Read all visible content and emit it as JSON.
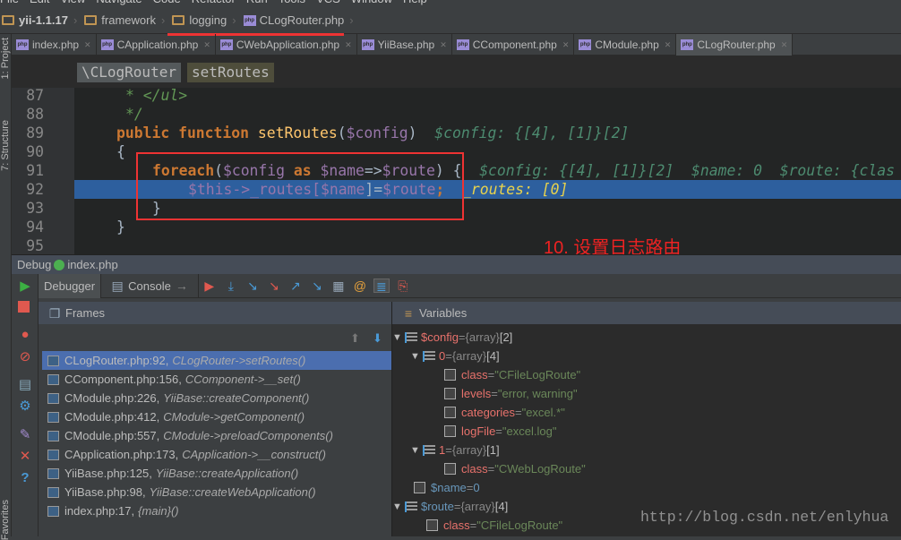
{
  "menu": [
    "File",
    "Edit",
    "View",
    "Navigate",
    "Code",
    "Refactor",
    "Run",
    "Tools",
    "VCS",
    "Window",
    "Help"
  ],
  "breadcrumb": [
    "yii-1.1.17",
    "framework",
    "logging",
    "CLogRouter.php"
  ],
  "side_labels": {
    "project": "1: Project",
    "structure": "7: Structure",
    "favorites": "Favorites"
  },
  "tabs": [
    "index.php",
    "CApplication.php",
    "CWebApplication.php",
    "YiiBase.php",
    "CComponent.php",
    "CModule.php",
    "CLogRouter.php"
  ],
  "active_tab": "CLogRouter.php",
  "editor_nav": {
    "class": "\\CLogRouter",
    "method": "setRoutes"
  },
  "code": {
    "lines": [
      "87",
      "88",
      "89",
      "90",
      "91",
      "92",
      "93",
      "94",
      "95"
    ],
    "l87": "* </ul>",
    "l88": "*/",
    "l89_kw": "public function ",
    "l89_fn": "setRoutes",
    "l89_p1": "(",
    "l89_v": "$config",
    "l89_p2": ")",
    "l89_dbg": "$config: {[4], [1]}[2]",
    "l90": "{",
    "l91_kw": "foreach",
    "l91_p1": "(",
    "l91_v1": "$config",
    "l91_as": " as ",
    "l91_v2": "$name",
    "l91_arrow": "=>",
    "l91_v3": "$route",
    "l91_p2": ") {",
    "l91_dbg": "$config: {[4], [1]}[2]  $name: 0  $route: {clas",
    "l92_a": "$this->_routes[",
    "l92_b": "$name",
    "l92_c": "]=",
    "l92_d": "$route",
    "l92_e": ";",
    "l92_dbg1": "_routes: ",
    "l92_dbg2": "[0]",
    "l93": "}",
    "l94": "}"
  },
  "annotation": "10. 设置日志路由",
  "debug": {
    "title": "Debug",
    "config": "index.php",
    "tab_debugger": "Debugger",
    "tab_console": "Console"
  },
  "frames": {
    "title": "Frames",
    "items": [
      {
        "loc": "CLogRouter.php:92,",
        "fn": "CLogRouter->setRoutes()"
      },
      {
        "loc": "CComponent.php:156,",
        "fn": "CComponent->__set()"
      },
      {
        "loc": "CModule.php:226,",
        "fn": "YiiBase::createComponent()"
      },
      {
        "loc": "CModule.php:412,",
        "fn": "CModule->getComponent()"
      },
      {
        "loc": "CModule.php:557,",
        "fn": "CModule->preloadComponents()"
      },
      {
        "loc": "CApplication.php:173,",
        "fn": "CApplication->__construct()"
      },
      {
        "loc": "YiiBase.php:125,",
        "fn": "YiiBase::createApplication()"
      },
      {
        "loc": "YiiBase.php:98,",
        "fn": "YiiBase::createWebApplication()"
      },
      {
        "loc": "index.php:17,",
        "fn": "{main}()"
      }
    ]
  },
  "variables": {
    "title": "Variables",
    "items": [
      {
        "name": "$config",
        "type": "{array}",
        "val": "[2]",
        "kind": "array",
        "indent": 0,
        "tri": true,
        "blue": false
      },
      {
        "name": "0",
        "type": "{array}",
        "val": "[4]",
        "kind": "array",
        "indent": 1,
        "tri": true,
        "blue": false
      },
      {
        "name": "class",
        "type": "",
        "val": "\"CFileLogRoute\"",
        "kind": "prim",
        "indent": 2,
        "tri": false,
        "blue": false
      },
      {
        "name": "levels",
        "type": "",
        "val": "\"error, warning\"",
        "kind": "prim",
        "indent": 2,
        "tri": false,
        "blue": false
      },
      {
        "name": "categories",
        "type": "",
        "val": "\"excel.*\"",
        "kind": "prim",
        "indent": 2,
        "tri": false,
        "blue": false
      },
      {
        "name": "logFile",
        "type": "",
        "val": "\"excel.log\"",
        "kind": "prim",
        "indent": 2,
        "tri": false,
        "blue": false
      },
      {
        "name": "1",
        "type": "{array}",
        "val": "[1]",
        "kind": "array",
        "indent": 1,
        "tri": true,
        "blue": false
      },
      {
        "name": "class",
        "type": "",
        "val": "\"CWebLogRoute\"",
        "kind": "prim",
        "indent": 2,
        "tri": false,
        "blue": false
      },
      {
        "name": "$name",
        "type": "",
        "val": "0",
        "kind": "prim",
        "indent": 0,
        "tri": false,
        "blue": true
      },
      {
        "name": "$route",
        "type": "{array}",
        "val": "[4]",
        "kind": "array",
        "indent": 0,
        "tri": true,
        "blue": true
      },
      {
        "name": "class",
        "type": "",
        "val": "\"CFileLogRoute\"",
        "kind": "prim",
        "indent": 1,
        "tri": false,
        "blue": false
      }
    ]
  },
  "watermark": "http://blog.csdn.net/enlyhua",
  "colors": {
    "highlight": "#2d5f9e",
    "keyword": "#cc7832",
    "variable": "#9876aa",
    "annotation_red": "#ee3333"
  }
}
